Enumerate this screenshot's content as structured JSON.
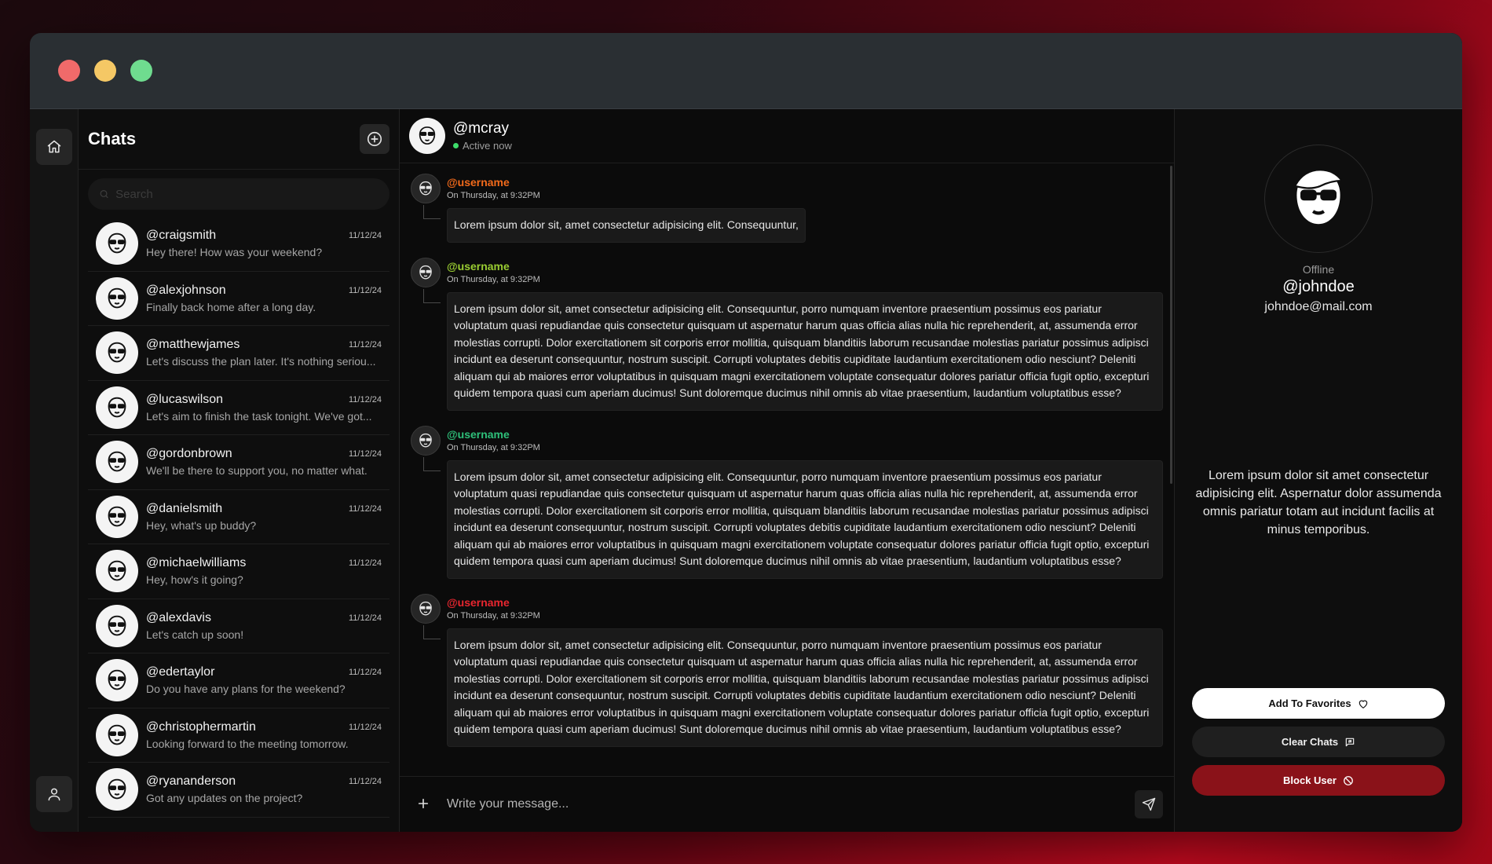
{
  "window": {
    "controls": [
      "close",
      "minimize",
      "maximize"
    ]
  },
  "rail": {
    "home_icon": "home-icon",
    "user_icon": "user-icon"
  },
  "chatlist": {
    "title": "Chats",
    "new_chat_icon": "plus-circle-icon",
    "search_placeholder": "Search",
    "items": [
      {
        "name": "@craigsmith",
        "date": "11/12/24",
        "preview": "Hey there! How was your weekend?"
      },
      {
        "name": "@alexjohnson",
        "date": "11/12/24",
        "preview": "Finally back home after a long day."
      },
      {
        "name": "@matthewjames",
        "date": "11/12/24",
        "preview": "Let's discuss the plan later. It's nothing seriou..."
      },
      {
        "name": "@lucaswilson",
        "date": "11/12/24",
        "preview": "Let's aim to finish the task tonight. We've got..."
      },
      {
        "name": "@gordonbrown",
        "date": "11/12/24",
        "preview": "We'll be there to support you, no matter what."
      },
      {
        "name": "@danielsmith",
        "date": "11/12/24",
        "preview": "Hey, what's up buddy?"
      },
      {
        "name": "@michaelwilliams",
        "date": "11/12/24",
        "preview": "Hey, how's it going?"
      },
      {
        "name": "@alexdavis",
        "date": "11/12/24",
        "preview": "Let's catch up soon!"
      },
      {
        "name": "@edertaylor",
        "date": "11/12/24",
        "preview": "Do you have any plans for the weekend?"
      },
      {
        "name": "@christophermartin",
        "date": "11/12/24",
        "preview": "Looking forward to the meeting tomorrow."
      },
      {
        "name": "@ryananderson",
        "date": "11/12/24",
        "preview": "Got any updates on the project?"
      }
    ]
  },
  "conversation": {
    "user": "@mcray",
    "status": "Active now",
    "messages": [
      {
        "user": "@username",
        "color": "#f26a1b",
        "time": "On Thursday, at 9:32PM",
        "text": "Lorem ipsum dolor sit, amet consectetur adipisicing elit. Consequuntur,"
      },
      {
        "user": "@username",
        "color": "#9acd32",
        "time": "On Thursday, at 9:32PM",
        "text": "Lorem ipsum dolor sit, amet consectetur adipisicing elit. Consequuntur, porro numquam inventore praesentium possimus eos pariatur voluptatum quasi repudiandae quis consectetur quisquam ut aspernatur harum quas officia alias nulla hic reprehenderit, at, assumenda error molestias corrupti. Dolor exercitationem sit corporis error mollitia, quisquam blanditiis laborum recusandae molestias pariatur possimus adipisci incidunt ea deserunt consequuntur, nostrum suscipit. Corrupti voluptates debitis cupiditate laudantium exercitationem odio nesciunt? Deleniti aliquam qui ab maiores error voluptatibus in quisquam magni exercitationem voluptate consequatur dolores pariatur officia fugit optio, excepturi quidem tempora quasi cum aperiam ducimus! Sunt doloremque ducimus nihil omnis ab vitae praesentium, laudantium voluptatibus esse?"
      },
      {
        "user": "@username",
        "color": "#2ec07a",
        "time": "On Thursday, at 9:32PM",
        "text": "Lorem ipsum dolor sit, amet consectetur adipisicing elit. Consequuntur, porro numquam inventore praesentium possimus eos pariatur voluptatum quasi repudiandae quis consectetur quisquam ut aspernatur harum quas officia alias nulla hic reprehenderit, at, assumenda error molestias corrupti. Dolor exercitationem sit corporis error mollitia, quisquam blanditiis laborum recusandae molestias pariatur possimus adipisci incidunt ea deserunt consequuntur, nostrum suscipit. Corrupti voluptates debitis cupiditate laudantium exercitationem odio nesciunt? Deleniti aliquam qui ab maiores error voluptatibus in quisquam magni exercitationem voluptate consequatur dolores pariatur officia fugit optio, excepturi quidem tempora quasi cum aperiam ducimus! Sunt doloremque ducimus nihil omnis ab vitae praesentium, laudantium voluptatibus esse?"
      },
      {
        "user": "@username",
        "color": "#e8262f",
        "time": "On Thursday, at 9:32PM",
        "text": "Lorem ipsum dolor sit, amet consectetur adipisicing elit. Consequuntur, porro numquam inventore praesentium possimus eos pariatur voluptatum quasi repudiandae quis consectetur quisquam ut aspernatur harum quas officia alias nulla hic reprehenderit, at, assumenda error molestias corrupti. Dolor exercitationem sit corporis error mollitia, quisquam blanditiis laborum recusandae molestias pariatur possimus adipisci incidunt ea deserunt consequuntur, nostrum suscipit. Corrupti voluptates debitis cupiditate laudantium exercitationem odio nesciunt? Deleniti aliquam qui ab maiores error voluptatibus in quisquam magni exercitationem voluptate consequatur dolores pariatur officia fugit optio, excepturi quidem tempora quasi cum aperiam ducimus! Sunt doloremque ducimus nihil omnis ab vitae praesentium, laudantium voluptatibus esse?"
      }
    ],
    "composer_placeholder": "Write your message...",
    "attach_icon": "plus-icon",
    "send_icon": "send-icon"
  },
  "profile": {
    "status": "Offline",
    "handle": "@johndoe",
    "email": "johndoe@mail.com",
    "bio": "Lorem ipsum dolor sit amet consectetur adipisicing elit. Aspernatur dolor assumenda omnis pariatur totam aut incidunt facilis at minus temporibus.",
    "buttons": {
      "favorites": "Add To Favorites",
      "clear": "Clear Chats",
      "block": "Block User"
    }
  },
  "colors": {
    "accent_block": "#8a1219",
    "online": "#3ddc6a"
  }
}
